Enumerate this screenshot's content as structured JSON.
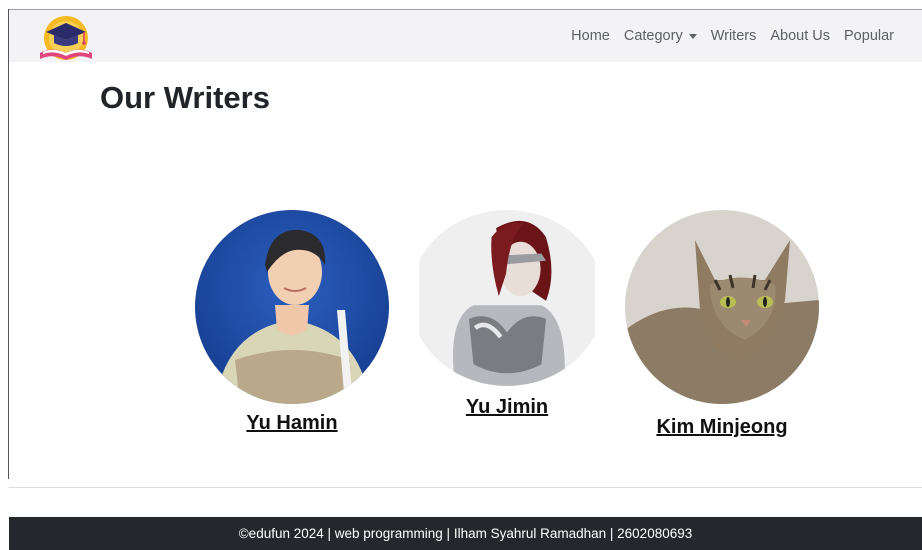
{
  "navbar": {
    "logo_icon": "graduation-cap-book-icon",
    "links": [
      {
        "label": "Home"
      },
      {
        "label": "Category",
        "dropdown": true
      },
      {
        "label": "Writers"
      },
      {
        "label": "About Us"
      },
      {
        "label": "Popular"
      }
    ]
  },
  "page": {
    "title": "Our Writers"
  },
  "writers": [
    {
      "name": "Yu Hamin"
    },
    {
      "name": "Yu Jimin"
    },
    {
      "name": "Kim Minjeong"
    }
  ],
  "footer": {
    "text": "©edufun 2024 | web programming | Ilham Syahrul Ramadhan | 2602080693"
  },
  "colors": {
    "navbar_bg": "#f3f3f6",
    "footer_bg": "#24282c",
    "text": "#212529"
  }
}
